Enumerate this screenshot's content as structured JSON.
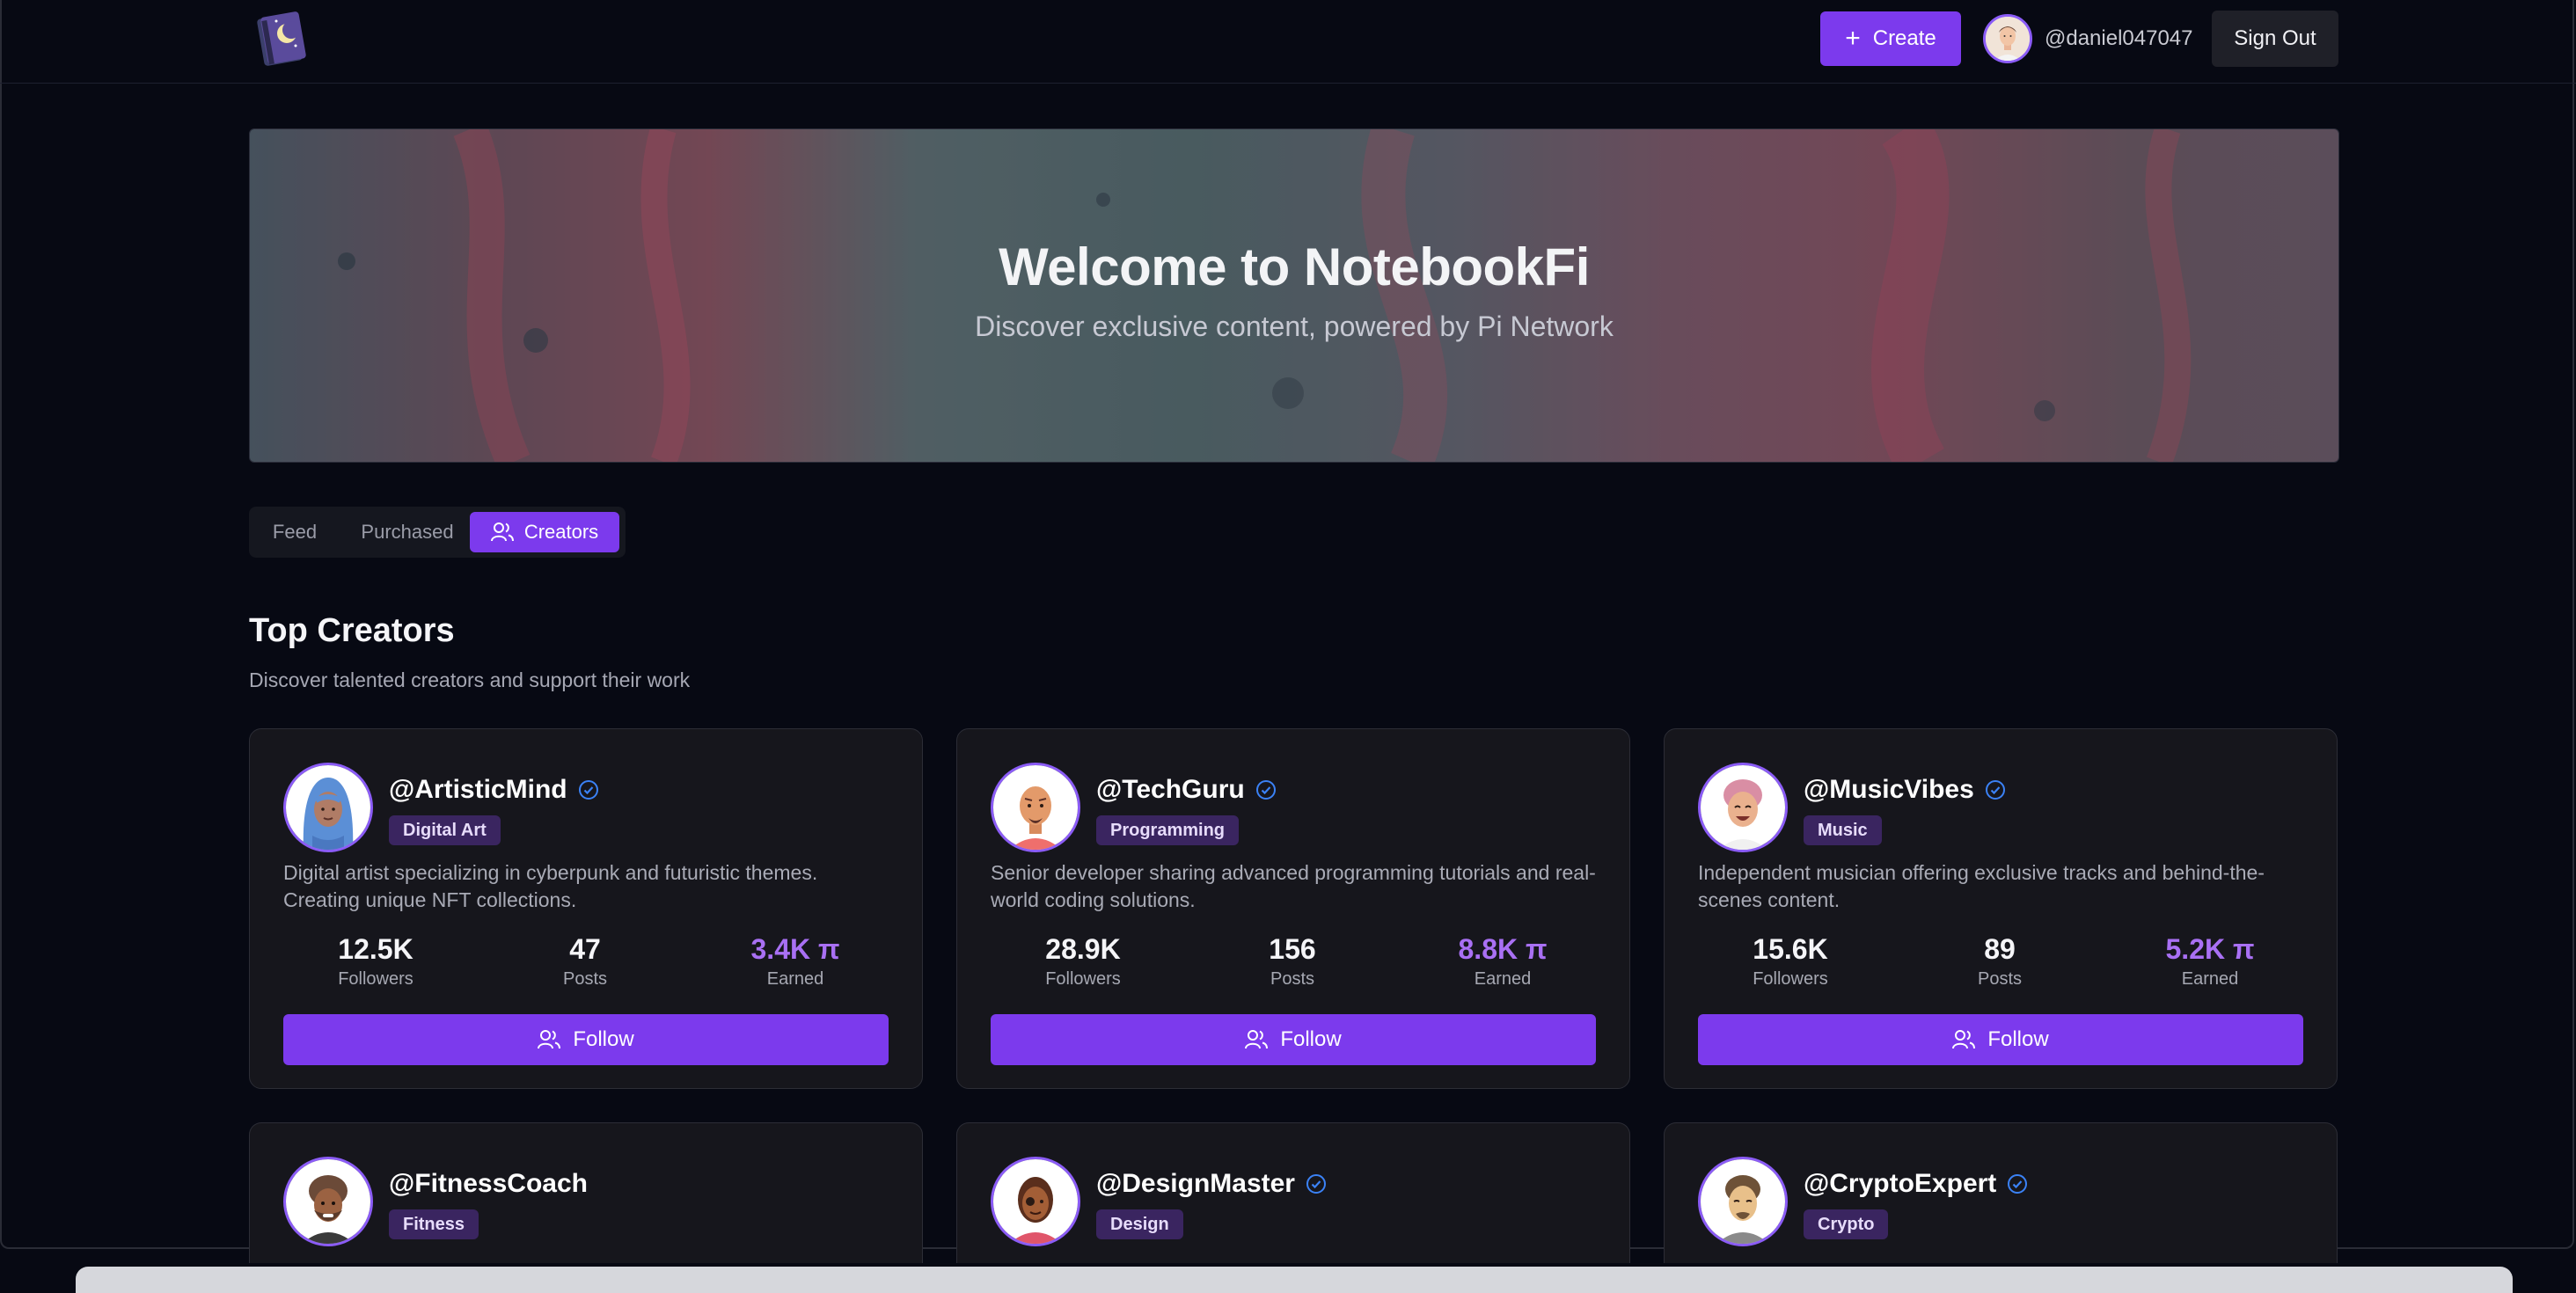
{
  "header": {
    "logo_icon": "notebook-moon-logo",
    "create_label": "Create",
    "username": "@daniel047047",
    "signout_label": "Sign Out"
  },
  "hero": {
    "title": "Welcome to NotebookFi",
    "subtitle": "Discover exclusive content, powered by Pi Network"
  },
  "tabs": [
    {
      "label": "Feed",
      "active": false
    },
    {
      "label": "Purchased",
      "active": false
    },
    {
      "label": "Creators",
      "active": true,
      "icon": "users-icon"
    }
  ],
  "section": {
    "title": "Top Creators",
    "subtitle": "Discover talented creators and support their work"
  },
  "creators": [
    {
      "handle": "@ArtisticMind",
      "verified": true,
      "category": "Digital Art",
      "bio": "Digital artist specializing in cyberpunk and futuristic themes. Creating unique NFT collections.",
      "followers": "12.5K",
      "posts": "47",
      "earned": "3.4K π",
      "followers_label": "Followers",
      "posts_label": "Posts",
      "earned_label": "Earned",
      "follow_label": "Follow"
    },
    {
      "handle": "@TechGuru",
      "verified": true,
      "category": "Programming",
      "bio": "Senior developer sharing advanced programming tutorials and real-world coding solutions.",
      "followers": "28.9K",
      "posts": "156",
      "earned": "8.8K π",
      "followers_label": "Followers",
      "posts_label": "Posts",
      "earned_label": "Earned",
      "follow_label": "Follow"
    },
    {
      "handle": "@MusicVibes",
      "verified": true,
      "category": "Music",
      "bio": "Independent musician offering exclusive tracks and behind-the-scenes content.",
      "followers": "15.6K",
      "posts": "89",
      "earned": "5.2K π",
      "followers_label": "Followers",
      "posts_label": "Posts",
      "earned_label": "Earned",
      "follow_label": "Follow"
    },
    {
      "handle": "@FitnessCoach",
      "verified": false,
      "category": "Fitness"
    },
    {
      "handle": "@DesignMaster",
      "verified": true,
      "category": "Design"
    },
    {
      "handle": "@CryptoExpert",
      "verified": true,
      "category": "Crypto"
    }
  ],
  "colors": {
    "accent": "#7c3aed",
    "background": "#070913",
    "card": "#16161c",
    "pi_value": "#a970f4",
    "verified": "#3b82f6"
  }
}
